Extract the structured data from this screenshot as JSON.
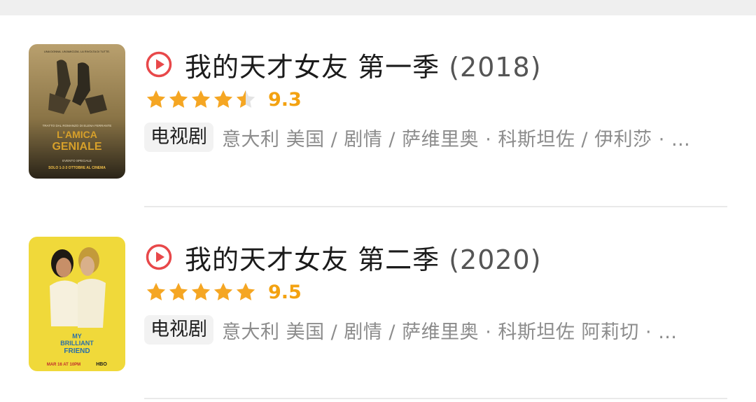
{
  "results": [
    {
      "title": "我的天才女友 第一季",
      "year": "(2018)",
      "rating": 4.5,
      "score": "9.3",
      "tag": "电视剧",
      "meta": "意大利 美国 / 剧情 / 萨维里奥 · 科斯坦佐 / 伊利莎 · …",
      "poster": {
        "top_text": "UNA DONNA. UN'AMICIZIA. LA RIVOLTA DI TUTTE.",
        "title_line1": "L'AMICA",
        "title_line2": "GENIALE",
        "subtitle": "TRATTO DAL ROMANZO DI ELENA FERRANTE",
        "event": "EVENTO SPECIALE",
        "dates": "SOLO 1-2-3 OTTOBRE AL CINEMA"
      }
    },
    {
      "title": "我的天才女友 第二季",
      "year": "(2020)",
      "rating": 5,
      "score": "9.5",
      "tag": "电视剧",
      "meta": "意大利 美国 / 剧情 / 萨维里奥 · 科斯坦佐 阿莉切 · …",
      "poster": {
        "title_line1": "MY",
        "title_line2": "BRILLIANT",
        "title_line3": "FRIEND",
        "date": "MAR 16 AT 10PM",
        "network": "HBO"
      }
    }
  ],
  "colors": {
    "accent_play": "#e8484a",
    "star": "#f5a623",
    "score": "#f3a211"
  }
}
